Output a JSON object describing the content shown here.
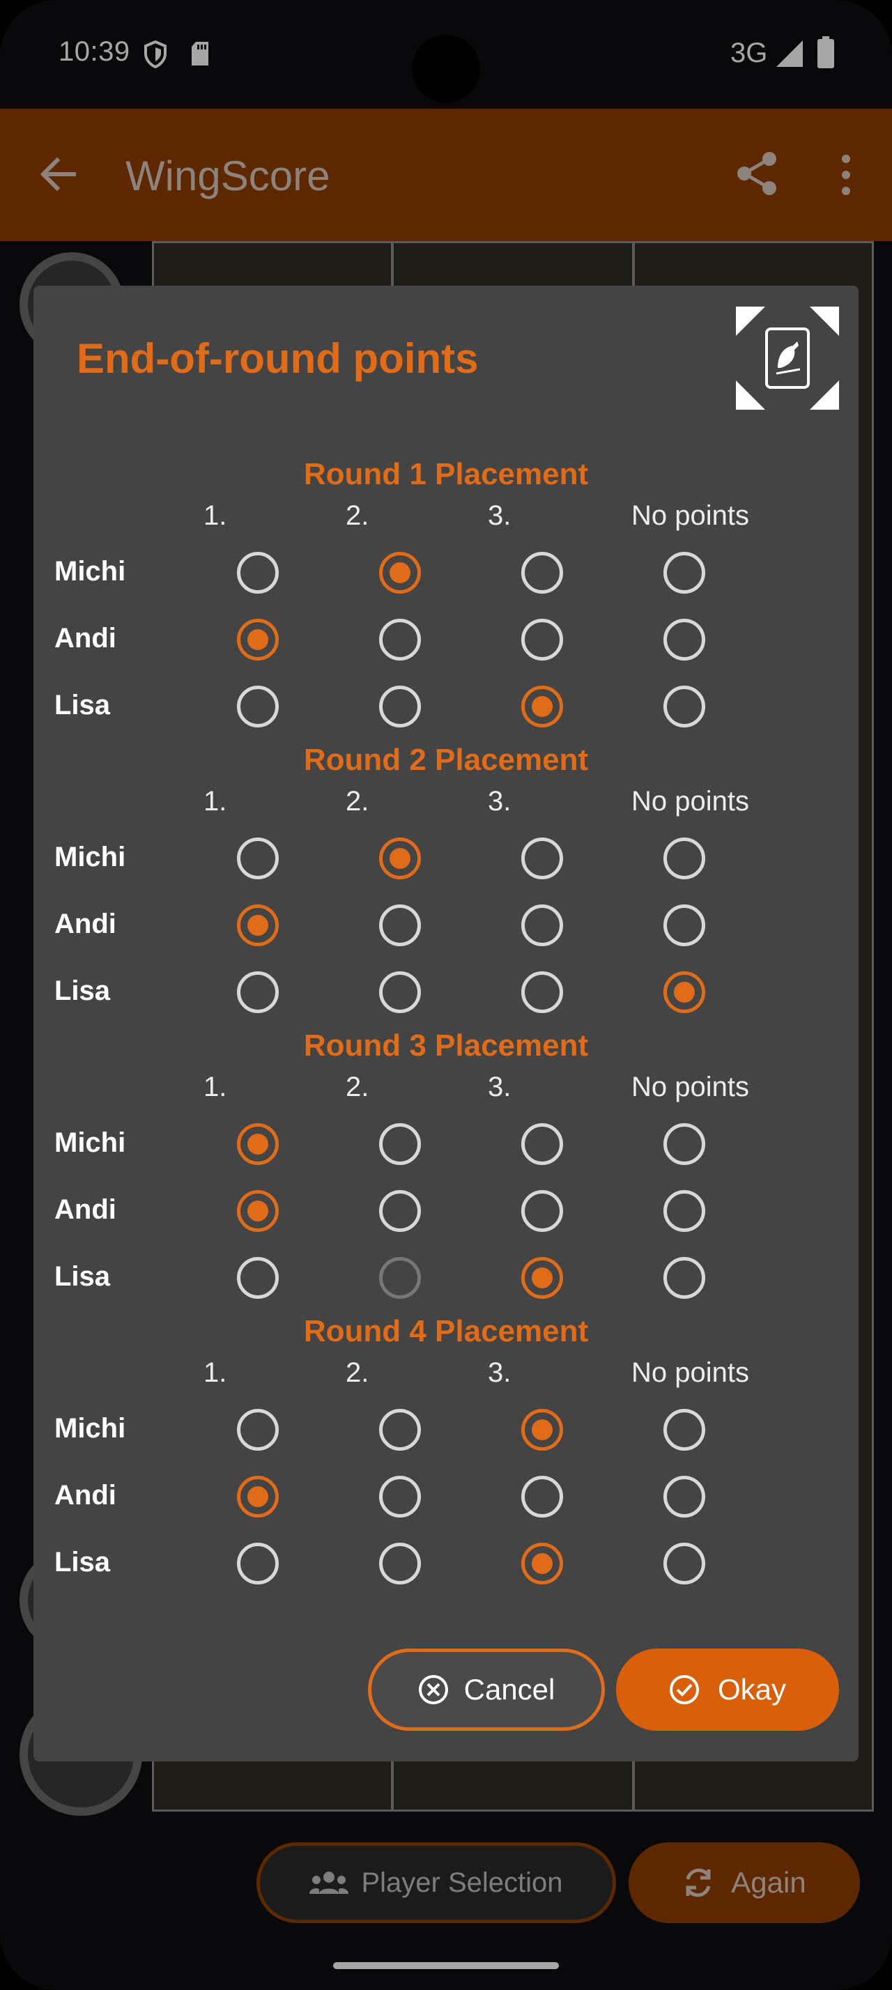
{
  "status_bar": {
    "time": "10:39",
    "network": "3G",
    "icons": [
      "shield-icon",
      "sd-card-icon",
      "signal-icon",
      "battery-icon"
    ]
  },
  "app_bar": {
    "title": "WingScore",
    "icons": [
      "back-arrow-icon",
      "share-icon",
      "more-vert-icon"
    ]
  },
  "dialog": {
    "title": "End-of-round points",
    "column_headers": [
      "1.",
      "2.",
      "3.",
      "No points"
    ],
    "rounds": [
      {
        "title": "Round 1 Placement",
        "rows": [
          {
            "player": "Michi",
            "selected": "2."
          },
          {
            "player": "Andi",
            "selected": "1."
          },
          {
            "player": "Lisa",
            "selected": "3."
          }
        ]
      },
      {
        "title": "Round 2 Placement",
        "rows": [
          {
            "player": "Michi",
            "selected": "2."
          },
          {
            "player": "Andi",
            "selected": "1."
          },
          {
            "player": "Lisa",
            "selected": "No points"
          }
        ]
      },
      {
        "title": "Round 3 Placement",
        "rows": [
          {
            "player": "Michi",
            "selected": "1."
          },
          {
            "player": "Andi",
            "selected": "1."
          },
          {
            "player": "Lisa",
            "selected": "3.",
            "disabled": [
              "2."
            ]
          }
        ]
      },
      {
        "title": "Round 4 Placement",
        "rows": [
          {
            "player": "Michi",
            "selected": "3."
          },
          {
            "player": "Andi",
            "selected": "1."
          },
          {
            "player": "Lisa",
            "selected": "3."
          }
        ]
      }
    ],
    "cancel_label": "Cancel",
    "okay_label": "Okay"
  },
  "bottom_bar": {
    "player_selection_label": "Player Selection",
    "again_label": "Again"
  },
  "colors": {
    "accent": "#e06b18",
    "app_bar": "#8f3e00",
    "dialog_bg": "#444444"
  }
}
